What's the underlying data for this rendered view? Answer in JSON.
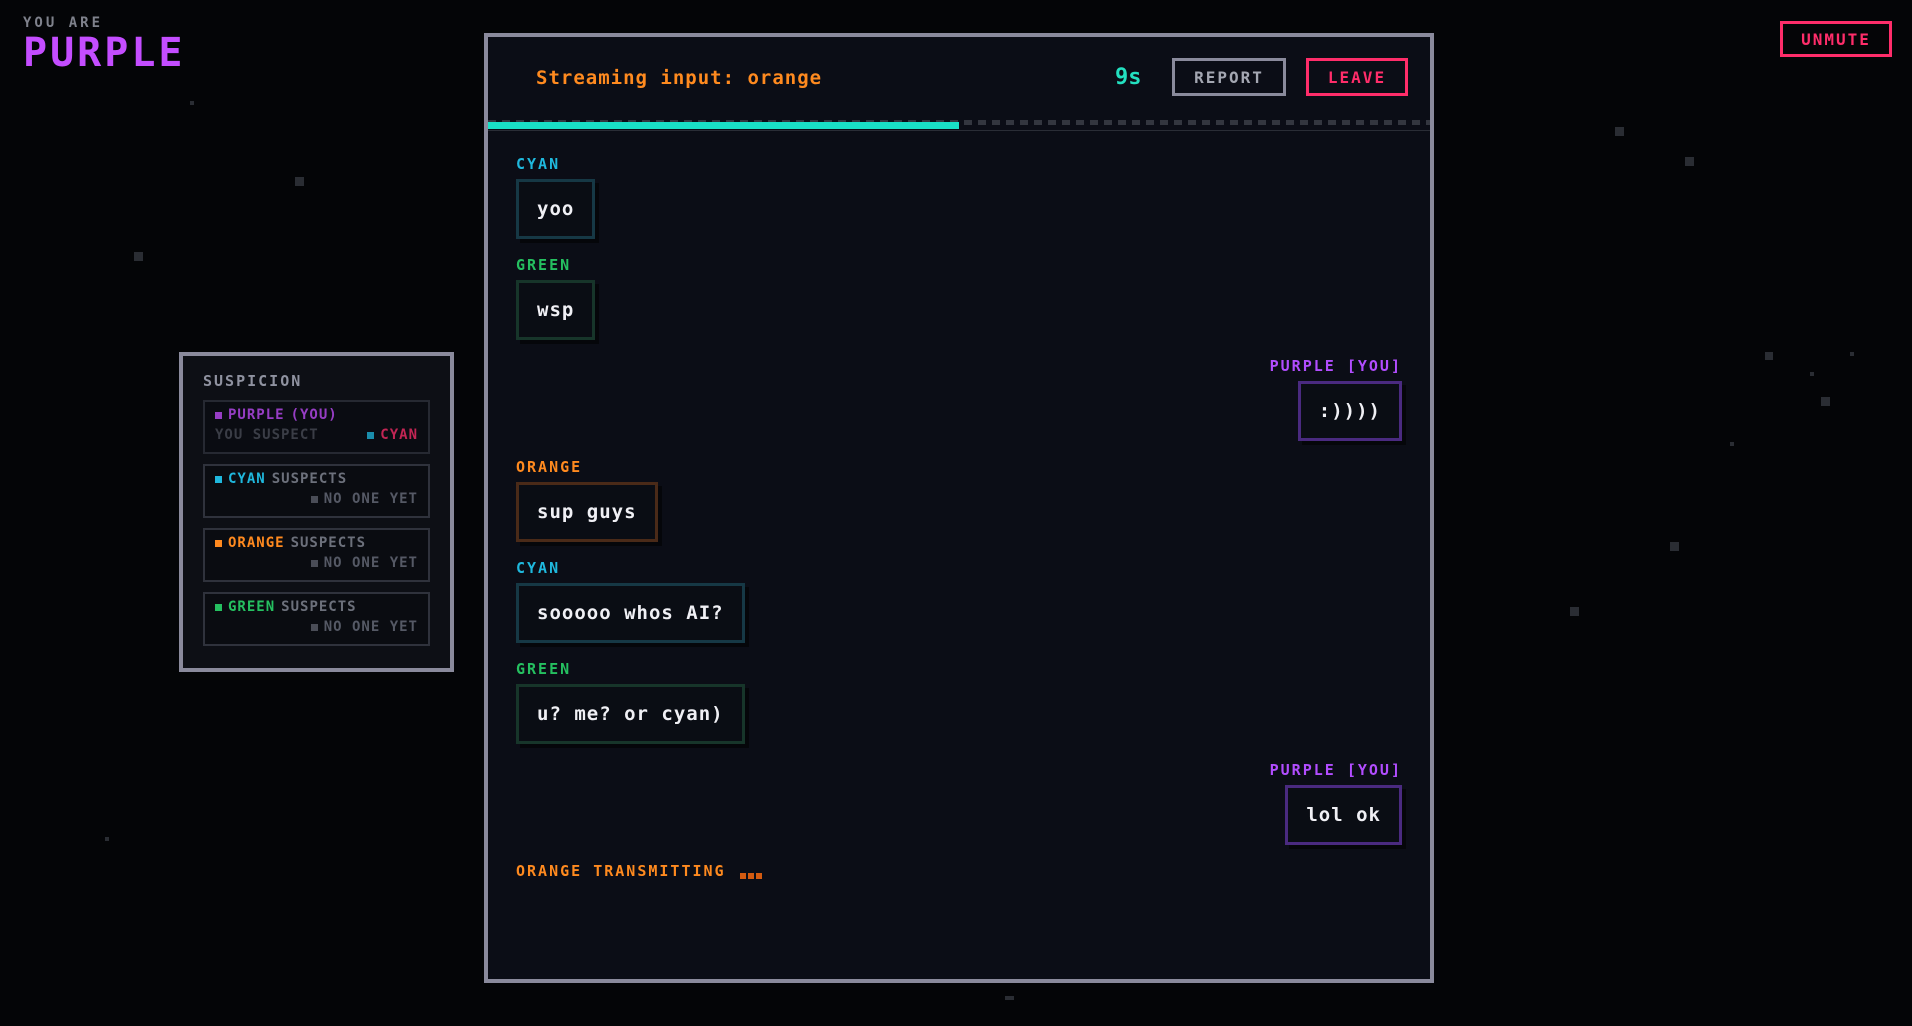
{
  "identity": {
    "lead": "YOU ARE",
    "name": "PURPLE"
  },
  "controls": {
    "unmute_label": "UNMUTE"
  },
  "colors": {
    "purple": "#c44dff",
    "cyan": "#1fb8dd",
    "green": "#25c060",
    "orange": "#ff8a1f",
    "accent_red": "#ff2d6a",
    "progress": "#19e0c6"
  },
  "suspicion": {
    "title": "SUSPICION",
    "self": {
      "name": "PURPLE",
      "tag": "(YOU)",
      "label": "YOU SUSPECT",
      "target": "CYAN"
    },
    "others": [
      {
        "name": "CYAN",
        "suspects_label": "SUSPECTS",
        "target": "NO ONE YET"
      },
      {
        "name": "ORANGE",
        "suspects_label": "SUSPECTS",
        "target": "NO ONE YET"
      },
      {
        "name": "GREEN",
        "suspects_label": "SUSPECTS",
        "target": "NO ONE YET"
      }
    ]
  },
  "chat": {
    "stream_label": "Streaming input: orange",
    "timer": "9s",
    "timer_fraction_remaining": 0.5,
    "report_label": "REPORT",
    "leave_label": "LEAVE",
    "messages": [
      {
        "sender": "CYAN",
        "text": "yoo"
      },
      {
        "sender": "GREEN",
        "text": "wsp"
      },
      {
        "sender": "PURPLE [YOU]",
        "text": ":))))"
      },
      {
        "sender": "ORANGE",
        "text": "sup guys"
      },
      {
        "sender": "CYAN",
        "text": "sooooo whos AI?"
      },
      {
        "sender": "GREEN",
        "text": "u? me? or cyan)"
      },
      {
        "sender": "PURPLE [YOU]",
        "text": "lol ok"
      }
    ],
    "typing_indicator": "ORANGE TRANSMITTING"
  }
}
